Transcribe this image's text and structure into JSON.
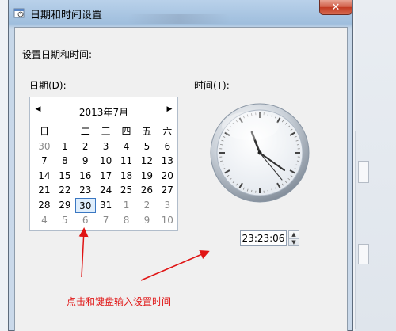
{
  "window": {
    "title": "日期和时间设置",
    "close_glyph": "✕"
  },
  "dialog": {
    "prompt": "设置日期和时间:",
    "date_label": "日期(D):",
    "time_label": "时间(T):"
  },
  "calendar": {
    "prev_glyph": "◀",
    "next_glyph": "▶",
    "month_title": "2013年7月",
    "weekdays": [
      "日",
      "一",
      "二",
      "三",
      "四",
      "五",
      "六"
    ],
    "weeks": [
      [
        "30",
        "1",
        "2",
        "3",
        "4",
        "5",
        "6"
      ],
      [
        "7",
        "8",
        "9",
        "10",
        "11",
        "12",
        "13"
      ],
      [
        "14",
        "15",
        "16",
        "17",
        "18",
        "19",
        "20"
      ],
      [
        "21",
        "22",
        "23",
        "24",
        "25",
        "26",
        "27"
      ],
      [
        "28",
        "29",
        "30",
        "31",
        "1",
        "2",
        "3"
      ],
      [
        "4",
        "5",
        "6",
        "7",
        "8",
        "9",
        "10"
      ]
    ],
    "selected_day": "30"
  },
  "time": {
    "value": "23:23:06",
    "spin_up": "▲",
    "spin_down": "▼"
  },
  "annotation": {
    "text": "点击和键盘输入设置时间",
    "color": "#e01414"
  }
}
